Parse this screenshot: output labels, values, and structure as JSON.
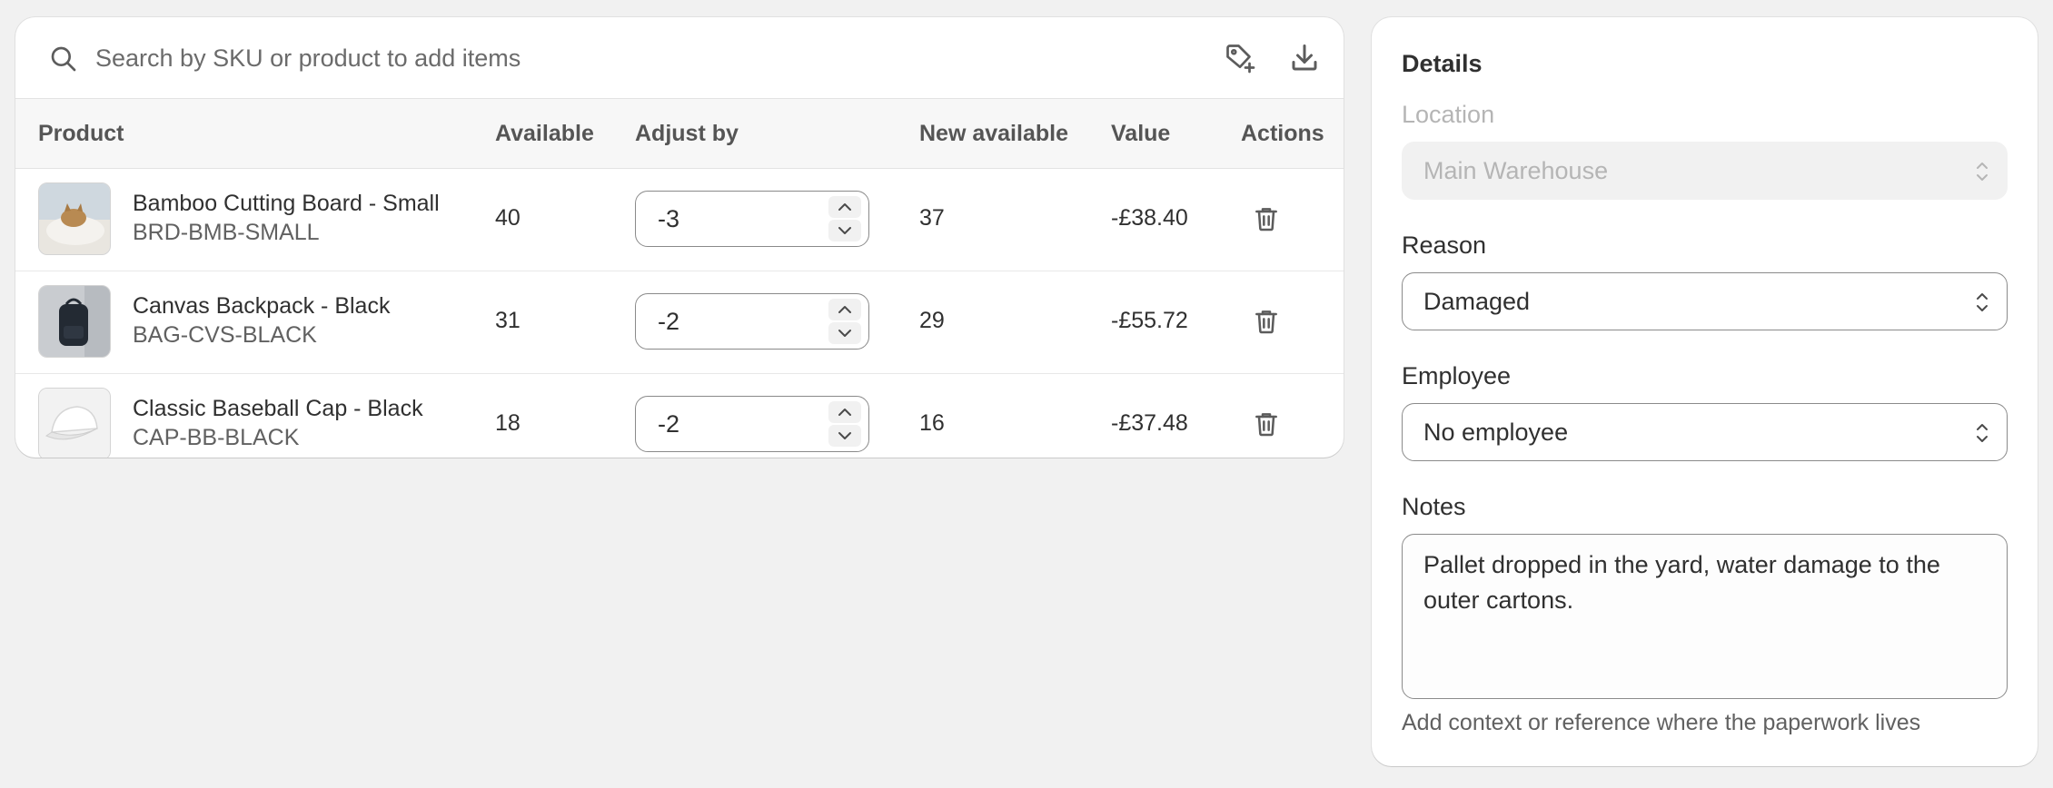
{
  "search": {
    "placeholder": "Search by SKU or product to add items"
  },
  "table": {
    "headers": {
      "product": "Product",
      "available": "Available",
      "adjust_by": "Adjust by",
      "new_available": "New available",
      "value": "Value",
      "actions": "Actions"
    },
    "rows": [
      {
        "name": "Bamboo Cutting Board - Small",
        "sku": "BRD-BMB-SMALL",
        "available": "40",
        "adjust_by": "-3",
        "new_available": "37",
        "value": "-£38.40"
      },
      {
        "name": "Canvas Backpack - Black",
        "sku": "BAG-CVS-BLACK",
        "available": "31",
        "adjust_by": "-2",
        "new_available": "29",
        "value": "-£55.72"
      },
      {
        "name": "Classic Baseball Cap - Black",
        "sku": "CAP-BB-BLACK",
        "available": "18",
        "adjust_by": "-2",
        "new_available": "16",
        "value": "-£37.48"
      }
    ]
  },
  "details": {
    "title": "Details",
    "location": {
      "label": "Location",
      "value": "Main Warehouse"
    },
    "reason": {
      "label": "Reason",
      "value": "Damaged"
    },
    "employee": {
      "label": "Employee",
      "value": "No employee"
    },
    "notes": {
      "label": "Notes",
      "value": "Pallet dropped in the yard, water damage to the outer cartons.",
      "help": "Add context or reference where the paperwork lives"
    }
  },
  "colors": {
    "background": "#f1f1f1",
    "card": "#ffffff",
    "text": "#303030",
    "muted": "#616161"
  }
}
